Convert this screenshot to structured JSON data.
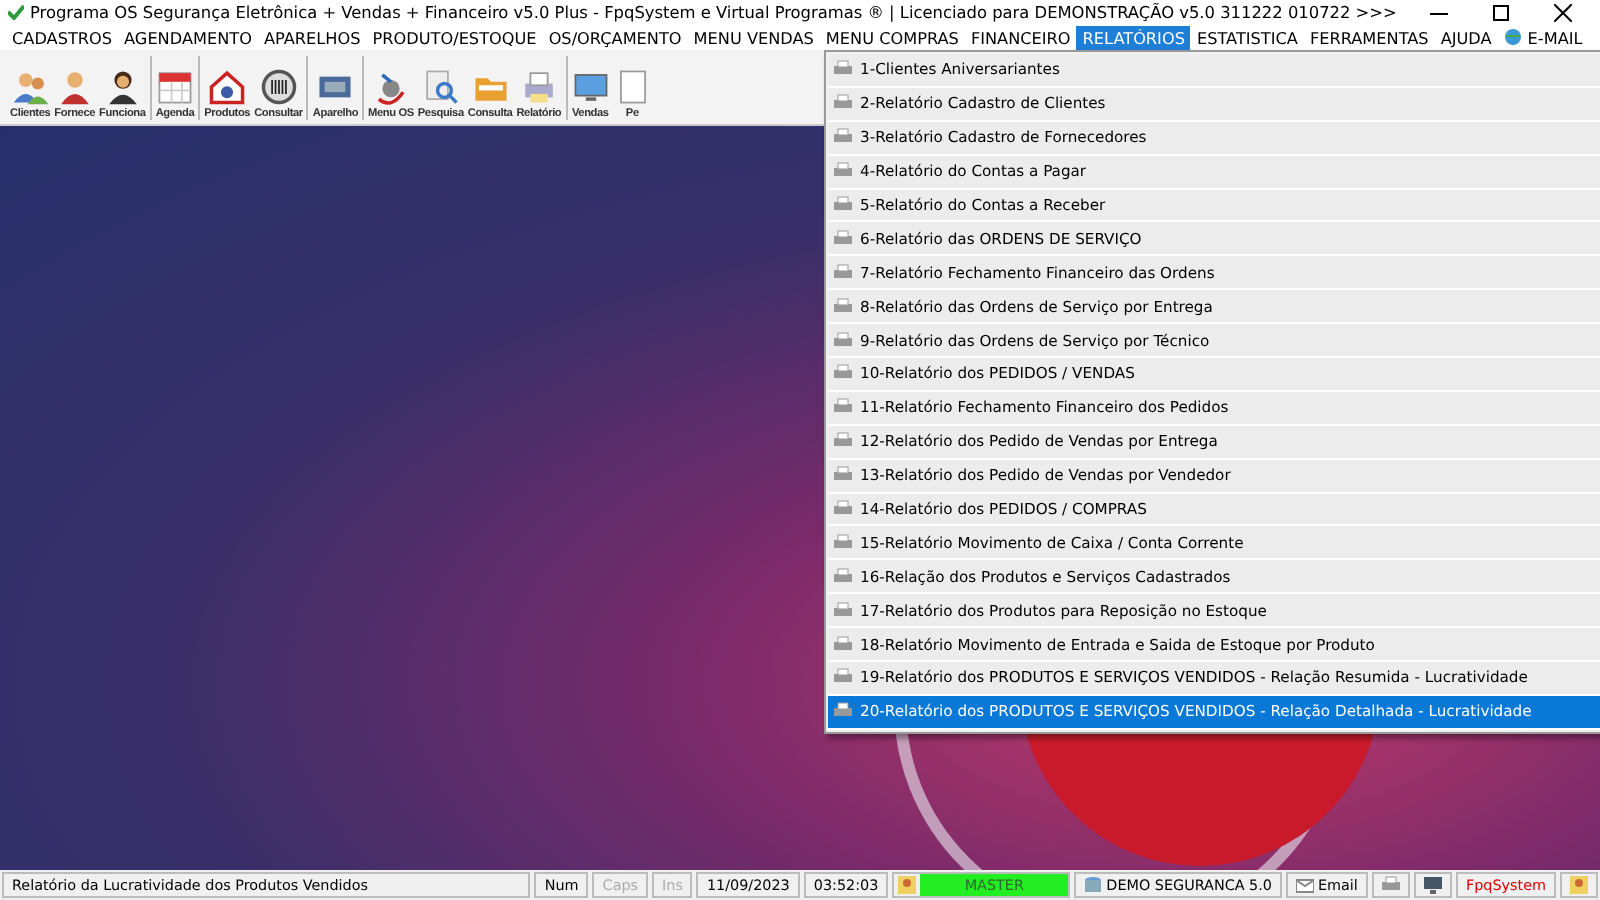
{
  "window": {
    "title": "Programa OS Segurança Eletrônica + Vendas + Financeiro v5.0 Plus - FpqSystem e Virtual Programas ® | Licenciado para  DEMONSTRAÇÃO v5.0 311222 010722 >>>"
  },
  "menu_bar": [
    {
      "label": "CADASTROS",
      "selected": false
    },
    {
      "label": "AGENDAMENTO",
      "selected": false
    },
    {
      "label": "APARELHOS",
      "selected": false
    },
    {
      "label": "PRODUTO/ESTOQUE",
      "selected": false
    },
    {
      "label": "OS/ORÇAMENTO",
      "selected": false
    },
    {
      "label": "MENU VENDAS",
      "selected": false
    },
    {
      "label": "MENU COMPRAS",
      "selected": false
    },
    {
      "label": "FINANCEIRO",
      "selected": false
    },
    {
      "label": "RELATÓRIOS",
      "selected": true
    },
    {
      "label": "ESTATISTICA",
      "selected": false
    },
    {
      "label": "FERRAMENTAS",
      "selected": false
    },
    {
      "label": "AJUDA",
      "selected": false
    },
    {
      "label": "E-MAIL",
      "selected": false,
      "kind": "email"
    }
  ],
  "toolbar": [
    {
      "label": "Clientes",
      "kind": "people",
      "group_start": false
    },
    {
      "label": "Fornece",
      "kind": "person",
      "group_start": false
    },
    {
      "label": "Funciona",
      "kind": "woman",
      "group_start": false
    },
    {
      "label": "Agenda",
      "kind": "calendar",
      "group_start": true
    },
    {
      "label": "Produtos",
      "kind": "house",
      "group_start": true
    },
    {
      "label": "Consultar",
      "kind": "barcode",
      "group_start": false
    },
    {
      "label": "Aparelho",
      "kind": "device",
      "group_start": true
    },
    {
      "label": "Menu OS",
      "kind": "camera",
      "group_start": true
    },
    {
      "label": "Pesquisa",
      "kind": "search",
      "group_start": false
    },
    {
      "label": "Consulta",
      "kind": "folder",
      "group_start": false
    },
    {
      "label": "Relatório",
      "kind": "printer",
      "group_start": false
    },
    {
      "label": "Vendas",
      "kind": "monitor",
      "group_start": true
    },
    {
      "label": "Pe",
      "kind": "doc",
      "group_start": false
    }
  ],
  "dropdown": [
    {
      "label": "1-Clientes Aniversariantes",
      "selected": false
    },
    {
      "label": "2-Relatório Cadastro de Clientes",
      "selected": false
    },
    {
      "label": "3-Relatório Cadastro de Fornecedores",
      "selected": false
    },
    {
      "label": "4-Relatório do Contas a Pagar",
      "selected": false
    },
    {
      "label": "5-Relatório do Contas a Receber",
      "selected": false
    },
    {
      "label": "6-Relatório das ORDENS DE SERVIÇO",
      "selected": false
    },
    {
      "label": "7-Relatório Fechamento Financeiro das Ordens",
      "selected": false
    },
    {
      "label": "8-Relatório das Ordens de Serviço por Entrega",
      "selected": false
    },
    {
      "label": "9-Relatório das Ordens de Serviço por Técnico",
      "selected": false
    },
    {
      "label": "10-Relatório dos PEDIDOS / VENDAS",
      "selected": false
    },
    {
      "label": "11-Relatório Fechamento Financeiro dos Pedidos",
      "selected": false
    },
    {
      "label": "12-Relatório dos Pedido de Vendas por Entrega",
      "selected": false
    },
    {
      "label": "13-Relatório dos Pedido de Vendas por Vendedor",
      "selected": false
    },
    {
      "label": "14-Relatório dos PEDIDOS / COMPRAS",
      "selected": false
    },
    {
      "label": "15-Relatório Movimento de Caixa / Conta Corrente",
      "selected": false
    },
    {
      "label": "16-Relação dos Produtos e Serviços Cadastrados",
      "selected": false
    },
    {
      "label": "17-Relatório dos Produtos para Reposição no Estoque",
      "selected": false
    },
    {
      "label": "18-Relatório Movimento de Entrada e Saida de Estoque por Produto",
      "selected": false
    },
    {
      "label": "19-Relatório dos PRODUTOS E SERVIÇOS VENDIDOS - Relação Resumida - Lucratividade",
      "selected": false
    },
    {
      "label": "20-Relatório dos PRODUTOS E SERVIÇOS VENDIDOS - Relação Detalhada - Lucratividade",
      "selected": true
    }
  ],
  "status_bar": {
    "message": "Relatório da Lucratividade dos Produtos Vendidos",
    "panels": [
      {
        "text": "Num",
        "kind": "key",
        "disabled": false
      },
      {
        "text": "Caps",
        "kind": "key",
        "disabled": true
      },
      {
        "text": "Ins",
        "kind": "key",
        "disabled": true
      },
      {
        "text": "11/09/2023",
        "kind": "plain"
      },
      {
        "text": "03:52:03",
        "kind": "plain"
      },
      {
        "text": "MASTER",
        "kind": "user"
      },
      {
        "text": "DEMO SEGURANCA 5.0",
        "kind": "db"
      },
      {
        "text": "Email",
        "kind": "mail"
      },
      {
        "kind": "printer"
      },
      {
        "kind": "terminal"
      },
      {
        "text": "FpqSystem",
        "kind": "brand"
      },
      {
        "kind": "user-icon"
      }
    ]
  }
}
